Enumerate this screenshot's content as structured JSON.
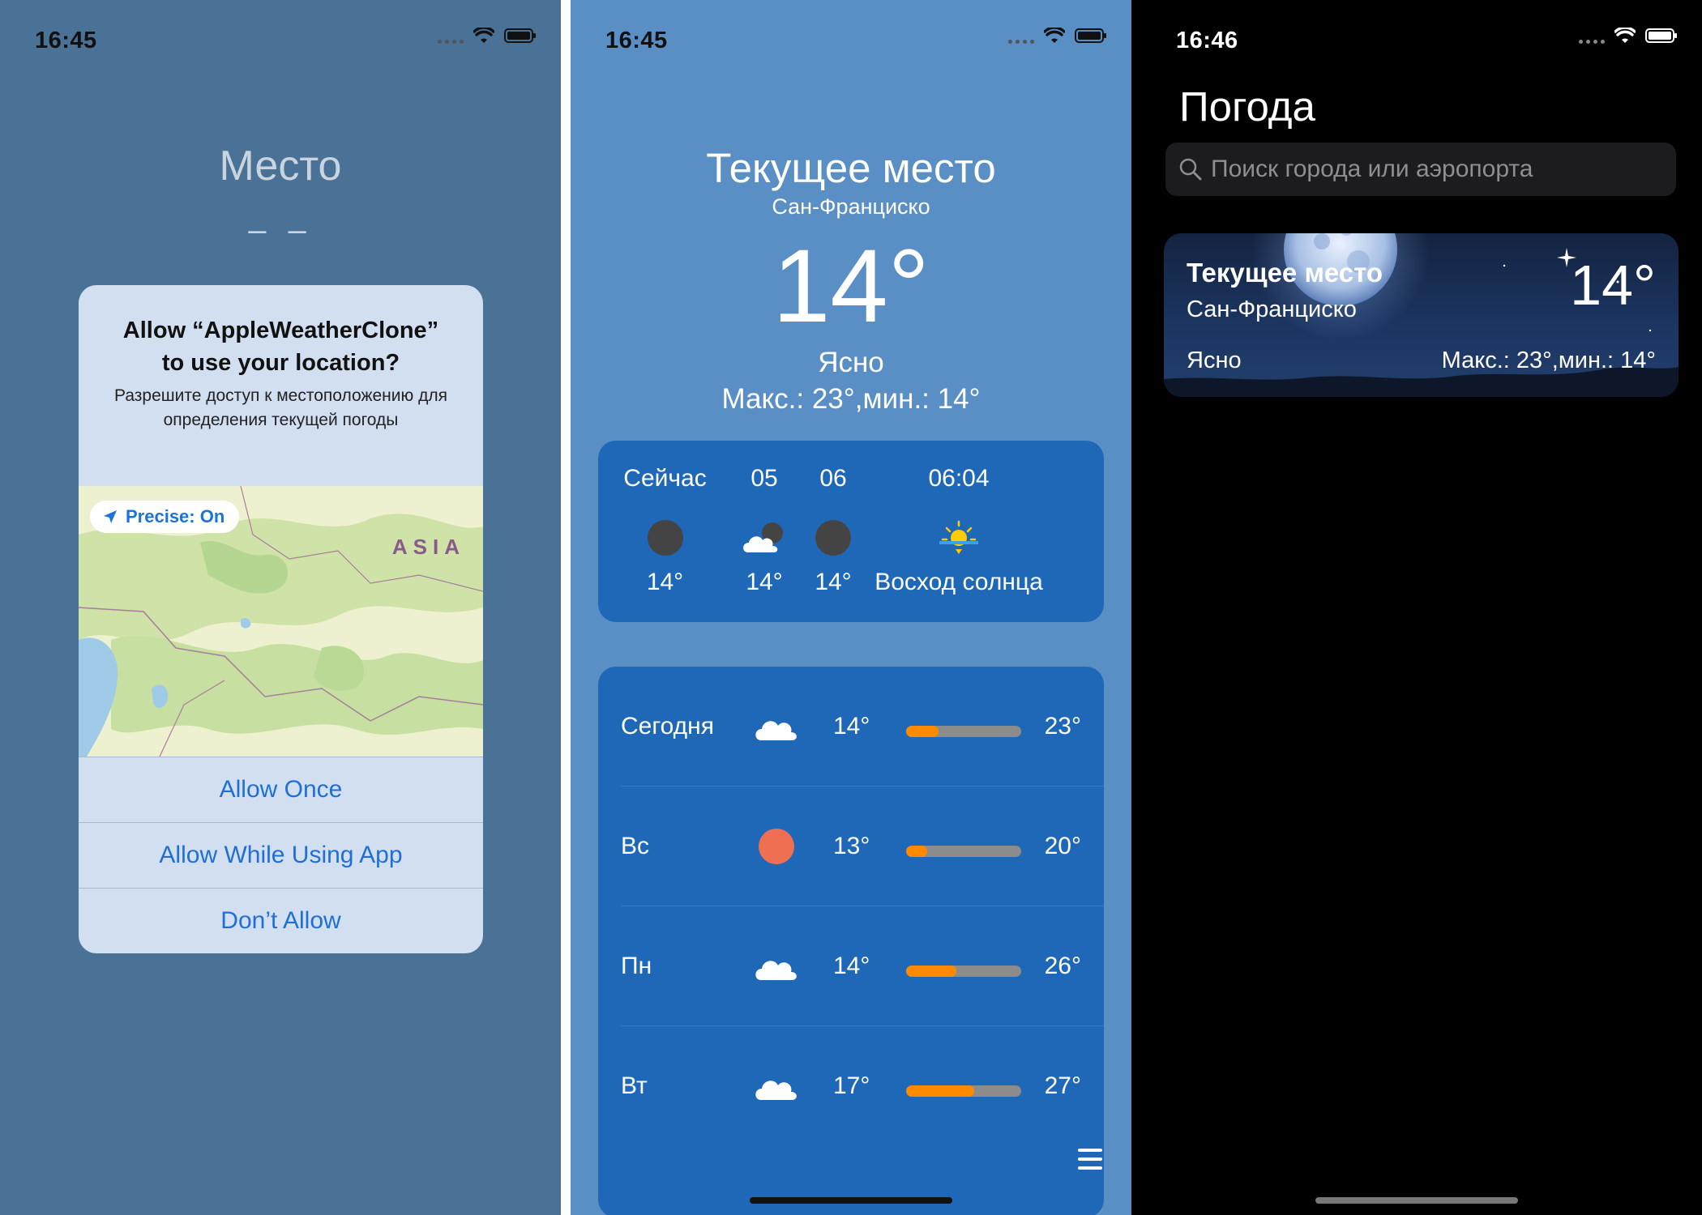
{
  "screens": [
    {
      "status": {
        "time": "16:45"
      },
      "title": "Место",
      "placeholder_temp": "– –",
      "alert": {
        "title_line1": "Allow “AppleWeatherClone”",
        "title_line2": "to use your location?",
        "message": "Разрешите доступ к местоположению для определения текущей погоды",
        "precise_label": "Precise: On",
        "map_region_label": "ASIA",
        "buttons": [
          "Allow Once",
          "Allow While Using App",
          "Don’t Allow"
        ]
      }
    },
    {
      "status": {
        "time": "16:45"
      },
      "location_title": "Текущее место",
      "city": "Сан-Франциско",
      "temperature": "14°",
      "condition": "Ясно",
      "hi_lo": "Макс.: 23°,мин.: 14°",
      "hourly": [
        {
          "label": "Сейчас",
          "icon": "moon-icon",
          "value": "14°"
        },
        {
          "label": "05",
          "icon": "cloud-moon-icon",
          "value": "14°"
        },
        {
          "label": "06",
          "icon": "moon-icon",
          "value": "14°"
        },
        {
          "label": "06:04",
          "icon": "sunrise-icon",
          "value": "Восход солнца"
        }
      ],
      "daily": [
        {
          "day": "Сегодня",
          "icon": "cloud-icon",
          "low": "14°",
          "high": "23°",
          "bar_fill": 0.28
        },
        {
          "day": "Вс",
          "icon": "sun-icon",
          "low": "13°",
          "high": "20°",
          "bar_fill": 0.18
        },
        {
          "day": "Пн",
          "icon": "cloud-icon",
          "low": "14°",
          "high": "26°",
          "bar_fill": 0.44
        },
        {
          "day": "Вт",
          "icon": "cloud-icon",
          "low": "17°",
          "high": "27°",
          "bar_fill": 0.59
        }
      ],
      "colors": {
        "bar_fill": "#ff8a00",
        "bar_track": "#8c8c8c",
        "panel": "#1f68b8"
      }
    },
    {
      "status": {
        "time": "16:46"
      },
      "title": "Погода",
      "search_placeholder": "Поиск города или аэропорта",
      "card": {
        "location": "Текущее место",
        "city": "Сан-Франциско",
        "temperature": "14°",
        "condition": "Ясно",
        "hi_lo": "Макс.: 23°,мин.: 14°"
      }
    }
  ]
}
